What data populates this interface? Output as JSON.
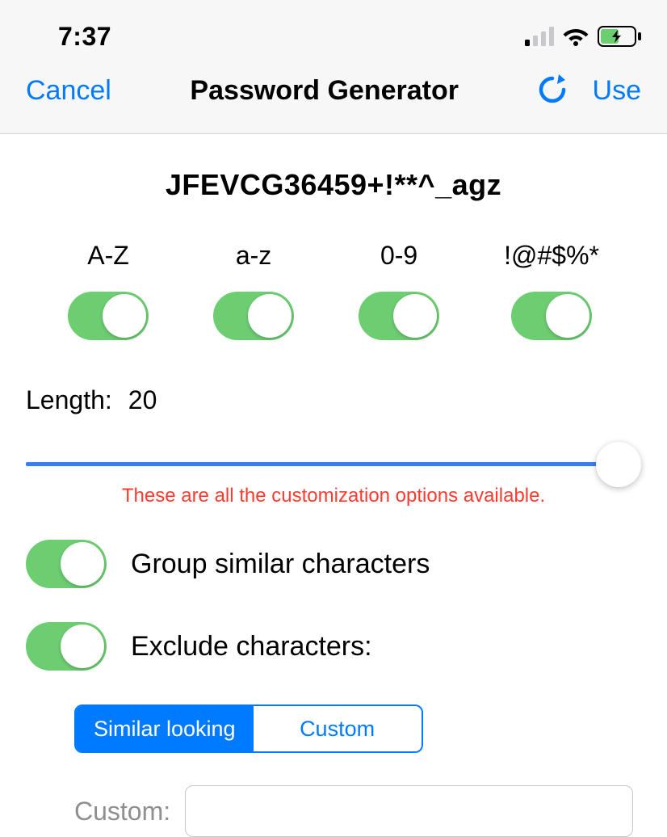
{
  "status": {
    "time": "7:37"
  },
  "header": {
    "cancel": "Cancel",
    "title": "Password Generator",
    "use": "Use"
  },
  "password": "JFEVCG36459+!**^_agz",
  "toggles": {
    "upper": {
      "label": "A-Z",
      "on": true
    },
    "lower": {
      "label": "a-z",
      "on": true
    },
    "digits": {
      "label": "0-9",
      "on": true
    },
    "symbols": {
      "label": "!@#$%*",
      "on": true
    }
  },
  "length": {
    "label": "Length:",
    "value": "20"
  },
  "note": "These are all the customization options available.",
  "options": {
    "group": {
      "label": "Group similar characters",
      "on": true
    },
    "exclude": {
      "label": "Exclude characters:",
      "on": true
    }
  },
  "segmented": {
    "similar": "Similar looking",
    "custom": "Custom",
    "active": "similar"
  },
  "custom": {
    "label": "Custom:",
    "value": ""
  }
}
